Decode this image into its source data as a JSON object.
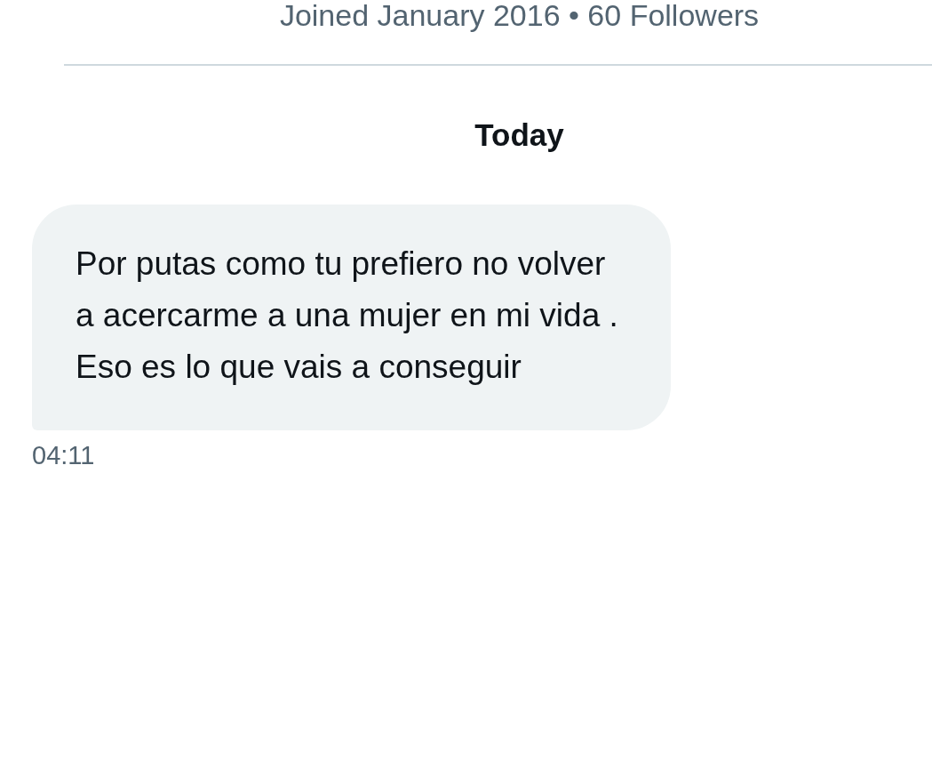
{
  "profile": {
    "joined_info": "Joined January 2016 • 60 Followers"
  },
  "date_separator": "Today",
  "messages": [
    {
      "kind": "incoming",
      "text": "Por putas como tu prefiero no volver a acercarme a una mujer en mi vida . Eso es lo que vais a conseguir",
      "time": "04:11"
    }
  ]
}
